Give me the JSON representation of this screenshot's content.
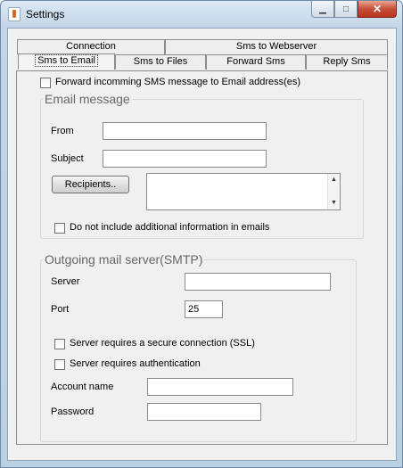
{
  "window": {
    "title": "Settings",
    "icons": {
      "app": "java-cup-icon",
      "minimize": "minimize-icon",
      "maximize": "maximize-icon",
      "close": "close-icon"
    },
    "minimize_glyph": "▁",
    "maximize_glyph": "□",
    "close_glyph": "✕"
  },
  "tabs": {
    "row1": [
      "Connection",
      "Sms to Webserver"
    ],
    "row2": [
      "Sms to Email",
      "Sms to Files",
      "Forward Sms",
      "Reply Sms"
    ],
    "selected": "Sms to Email"
  },
  "forward": {
    "label": "Forward incomming SMS message to Email address(es)",
    "checked": false
  },
  "email_message": {
    "title": "Email message",
    "from_label": "From",
    "from_value": "",
    "subject_label": "Subject",
    "subject_value": "",
    "recipients_button": "Recipients..",
    "recipients_value": "",
    "scroll_up_glyph": "▲",
    "scroll_down_glyph": "▼",
    "no_info_label": "Do not include additional information in emails",
    "no_info_checked": false
  },
  "smtp": {
    "title": "Outgoing mail server(SMTP)",
    "server_label": "Server",
    "server_value": "",
    "port_label": "Port",
    "port_value": "25",
    "ssl_label": "Server requires a secure connection (SSL)",
    "ssl_checked": false,
    "auth_label": "Server requires authentication",
    "auth_checked": false,
    "account_label": "Account name",
    "account_value": "",
    "password_label": "Password",
    "password_value": ""
  },
  "colors": {
    "titlebar": "#c3d5e8",
    "close_button": "#c7503a",
    "panel_bg": "#f0f0f0",
    "group_title": "#666666"
  }
}
